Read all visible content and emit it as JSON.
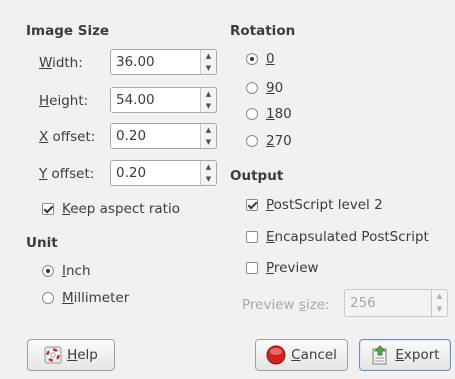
{
  "image_size": {
    "heading": "Image Size",
    "width": {
      "label_mn": "W",
      "label_rest": "idth:",
      "value": "36.00"
    },
    "height": {
      "label_mn": "H",
      "label_rest": "eight:",
      "value": "54.00"
    },
    "x_offset": {
      "label_mn": "X",
      "label_rest": " offset:",
      "value": "0.20"
    },
    "y_offset": {
      "label_mn": "Y",
      "label_rest": " offset:",
      "value": "0.20"
    },
    "keep_aspect": {
      "label_mn": "K",
      "label_rest": "eep aspect ratio",
      "checked": true
    }
  },
  "unit": {
    "heading": "Unit",
    "options": [
      {
        "label_mn": "I",
        "label_rest": "nch",
        "selected": true
      },
      {
        "label_mn": "M",
        "label_rest": "illimeter",
        "selected": false
      }
    ]
  },
  "rotation": {
    "heading": "Rotation",
    "options": [
      {
        "label_mn": "0",
        "label_rest": "",
        "selected": true
      },
      {
        "label_mn": "9",
        "label_rest": "0",
        "selected": false
      },
      {
        "label_mn": "1",
        "label_rest": "80",
        "selected": false
      },
      {
        "label_mn": "2",
        "label_rest": "70",
        "selected": false
      }
    ]
  },
  "output": {
    "heading": "Output",
    "postscript_level2": {
      "label_mn": "P",
      "label_rest": "ostScript level 2",
      "checked": true
    },
    "encapsulated": {
      "label_mn": "E",
      "label_rest": "ncapsulated PostScript",
      "checked": false
    },
    "preview": {
      "label_mn": "P",
      "label_rest": "review",
      "checked": false
    },
    "preview_size": {
      "label_pre": "Preview ",
      "label_mn": "s",
      "label_rest": "ize:",
      "value": "256"
    }
  },
  "buttons": {
    "help": {
      "label_mn": "H",
      "label_rest": "elp"
    },
    "cancel": {
      "label_mn": "C",
      "label_rest": "ancel"
    },
    "export": {
      "label_mn": "E",
      "label_rest": "xport"
    }
  },
  "icons": {
    "help": "help-lifebuoy-icon",
    "cancel": "cancel-red-circle-icon",
    "export": "export-document-icon"
  }
}
